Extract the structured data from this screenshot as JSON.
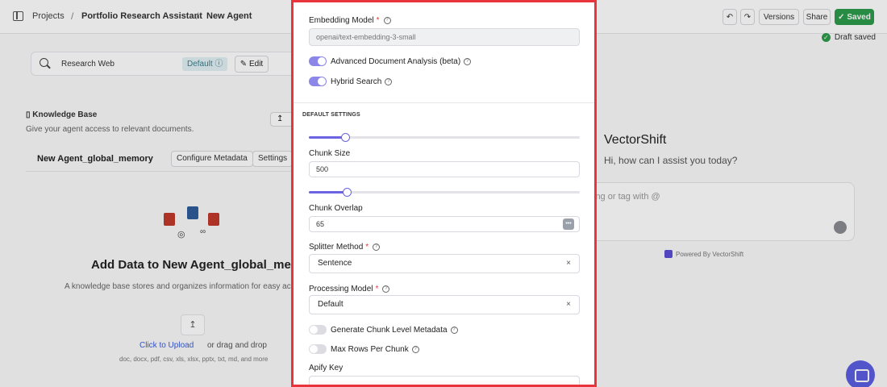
{
  "topbar": {
    "breadcrumb": [
      "Projects",
      "Portfolio Research Assistant",
      "New Agent"
    ],
    "versions_label": "Versions",
    "share_label": "Share",
    "saved_label": "Saved",
    "undo_icon": "undo-icon",
    "redo_icon": "redo-icon"
  },
  "draft_status": "Draft saved",
  "tool": {
    "name": "Research Web",
    "badge": "Default",
    "edit_label": "Edit"
  },
  "knowledge_base": {
    "title": "Knowledge Base",
    "subtitle": "Give your agent access to relevant documents.",
    "name": "New Agent_global_memory",
    "configure_label": "Configure Metadata",
    "settings_label": "Settings",
    "add_data_title": "Add Data to New Agent_global_memor",
    "description": "A knowledge base stores and organizes information for easy acces",
    "click_upload": "Click to Upload",
    "or_drag": "or drag and drop",
    "file_types": "doc, docx, pdf, csv, xls, xlsx, pptx, txt, md, and more"
  },
  "chat": {
    "title": "VectorShift",
    "greeting": "Hi, how can I assist you today?",
    "placeholder": "ing or tag with @",
    "powered_by": "Powered By VectorShift"
  },
  "modal": {
    "embedding_model_label": "Embedding Model",
    "embedding_model_value": "openai/text-embedding-3-small",
    "advanced_doc_label": "Advanced Document Analysis (beta)",
    "advanced_doc_on": true,
    "hybrid_search_label": "Hybrid Search",
    "hybrid_search_on": true,
    "section_title": "DEFAULT SETTINGS",
    "chunk_size_label": "Chunk Size",
    "chunk_size_value": "500",
    "chunk_size_slider": 0.135,
    "chunk_overlap_label": "Chunk Overlap",
    "chunk_overlap_value": "65",
    "chunk_overlap_slider": 0.14,
    "splitter_method_label": "Splitter Method",
    "splitter_method_value": "Sentence",
    "processing_model_label": "Processing Model",
    "processing_model_value": "Default",
    "generate_metadata_label": "Generate Chunk Level Metadata",
    "generate_metadata_on": false,
    "max_rows_label": "Max Rows Per Chunk",
    "max_rows_on": false,
    "apify_key_label": "Apify Key",
    "clear_symbol": "×",
    "required_mark": "*",
    "info_symbol": "?"
  },
  "colors": {
    "modal_border": "#e8343a",
    "accent": "#6b63e0",
    "saved_green": "#2d9b4b"
  }
}
